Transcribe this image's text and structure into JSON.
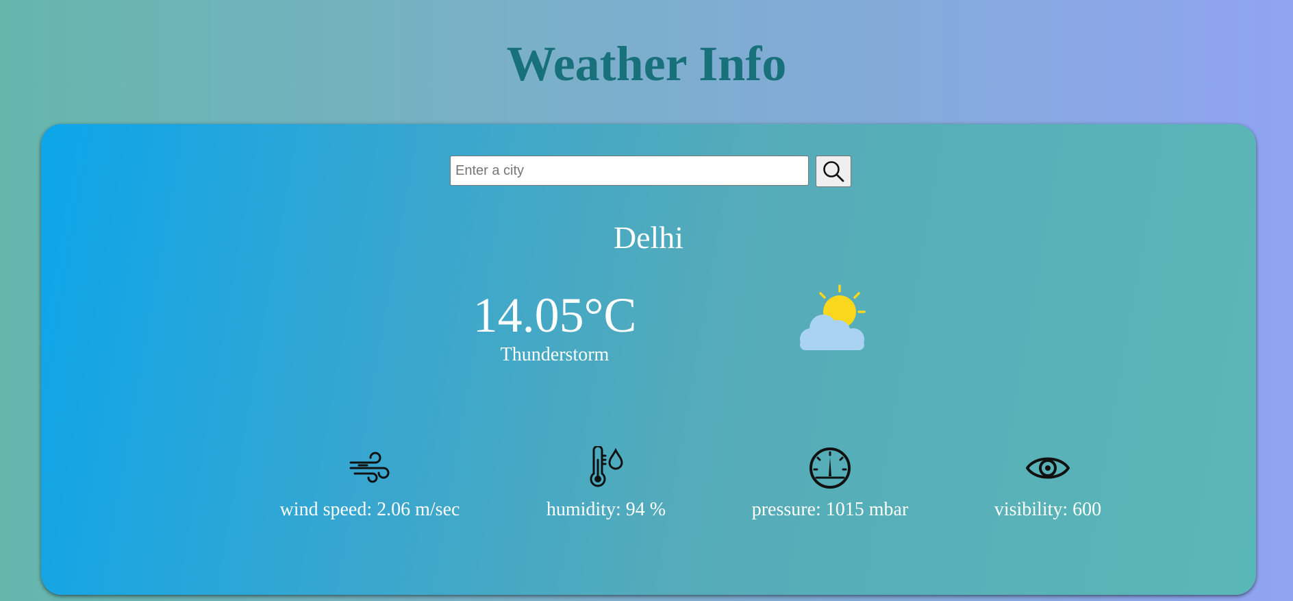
{
  "app": {
    "title": "Weather Info"
  },
  "search": {
    "placeholder": "Enter a city",
    "value": ""
  },
  "weather": {
    "city": "Delhi",
    "temperature": "14.05°C",
    "condition": "Thunderstorm",
    "icon": "partly-cloudy-icon"
  },
  "stats": [
    {
      "label": "wind speed: 2.06 m/sec",
      "icon": "wind-icon"
    },
    {
      "label": "humidity: 94 %",
      "icon": "thermometer-humidity-icon"
    },
    {
      "label": "pressure: 1015 mbar",
      "icon": "gauge-icon"
    },
    {
      "label": "visibility: 600",
      "icon": "eye-icon"
    }
  ],
  "colors": {
    "title": "#17707a",
    "sun": "#f9d71c",
    "cloud": "#a9d2f3"
  }
}
